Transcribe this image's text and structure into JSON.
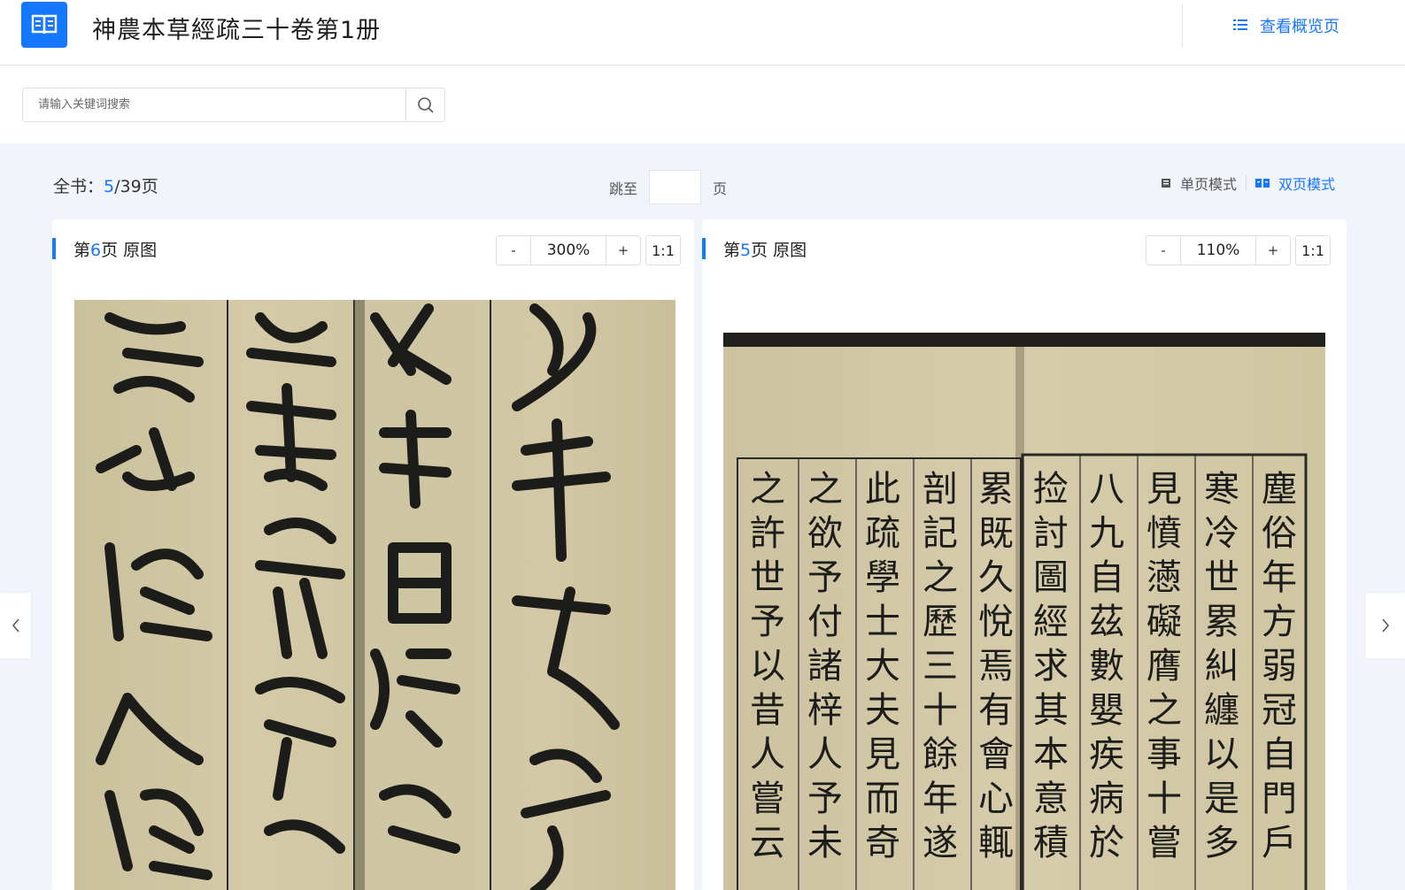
{
  "header": {
    "title": "神農本草經疏三十卷第1册",
    "overview_label": "查看概览页"
  },
  "search": {
    "placeholder": "请输入关键词搜索"
  },
  "pager": {
    "total_prefix": "全书：",
    "current": "5",
    "total_suffix": "/39页",
    "jump_label": "跳至",
    "jump_suffix": "页"
  },
  "modes": {
    "single_label": "单页模式",
    "double_label": "双页模式",
    "active": "double"
  },
  "panels": [
    {
      "prefix": "第",
      "page": "6",
      "suffix": "页 原图",
      "zoom": "300%",
      "minus": "-",
      "plus": "+",
      "reset": "1:1"
    },
    {
      "prefix": "第",
      "page": "5",
      "suffix": "页 原图",
      "zoom": "110%",
      "minus": "-",
      "plus": "+",
      "reset": "1:1"
    }
  ],
  "colors": {
    "accent": "#1677ff",
    "background": "#f1f5fb",
    "paper": "#d2c8a5",
    "ink": "#1c1c1a"
  }
}
